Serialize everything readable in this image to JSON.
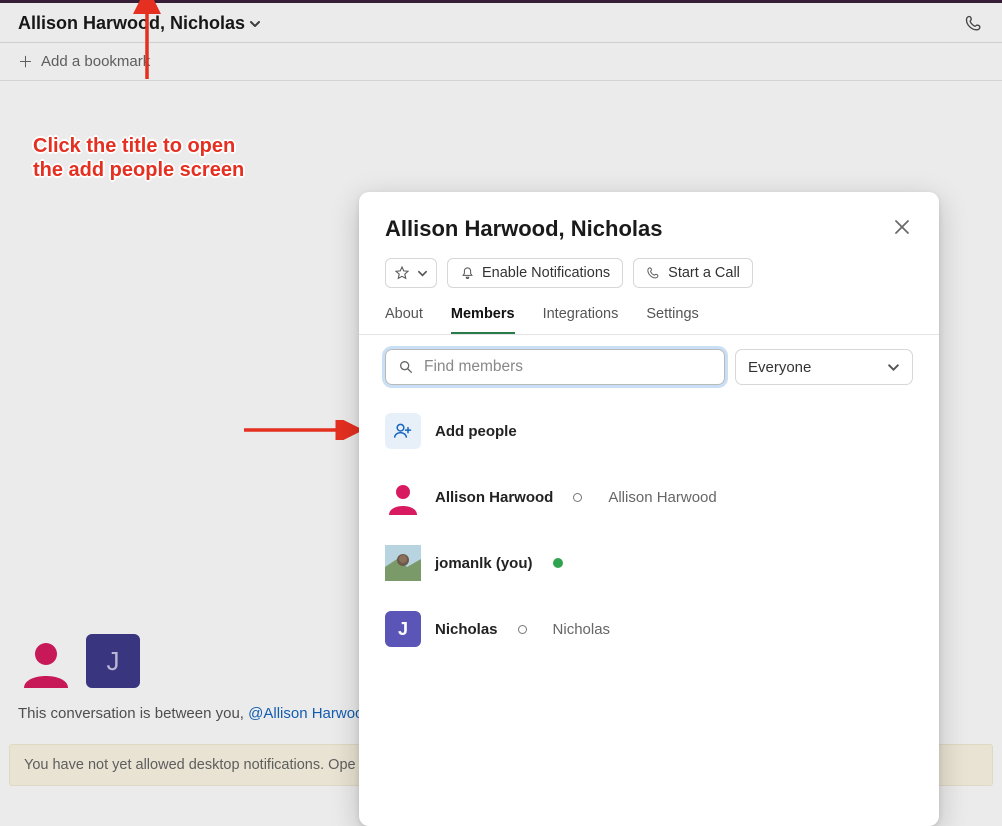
{
  "header": {
    "title": "Allison Harwood, Nicholas",
    "bookmark": "Add a bookmark"
  },
  "annotations": {
    "line1": "Click the title to open",
    "line2": "the add people screen"
  },
  "background": {
    "conversation_prefix": "This conversation is between you, ",
    "conversation_mention": "@Allison Harwoo",
    "notif_text": "You have not yet allowed desktop notifications. Ope",
    "avatar_j": "J"
  },
  "modal": {
    "title": "Allison Harwood, Nicholas",
    "notifications": "Enable Notifications",
    "call": "Start a Call",
    "tabs": {
      "about": "About",
      "members": "Members",
      "integrations": "Integrations",
      "settings": "Settings"
    },
    "search_placeholder": "Find members",
    "filter": "Everyone",
    "add_people": "Add people",
    "members": [
      {
        "name": "Allison Harwood",
        "sub": "Allison Harwood"
      },
      {
        "name": "jomanlk (you)"
      },
      {
        "name": "Nicholas",
        "sub": "Nicholas",
        "initial": "J"
      }
    ]
  }
}
